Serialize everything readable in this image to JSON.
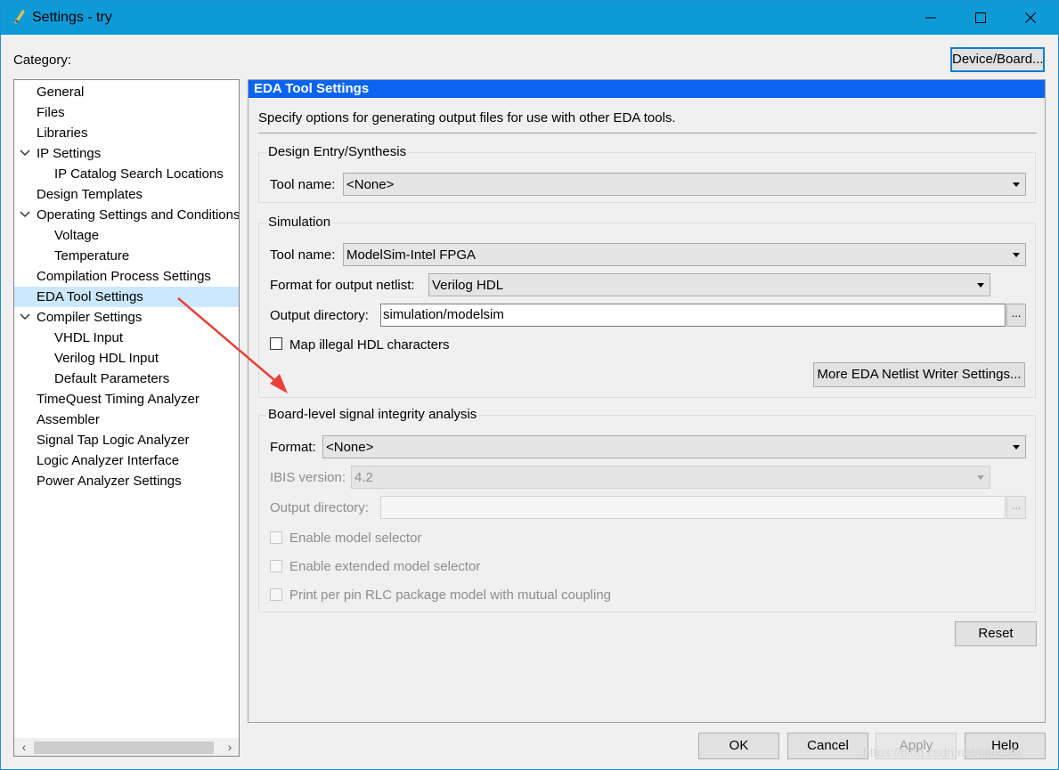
{
  "window": {
    "title": "Settings - try"
  },
  "category_label": "Category:",
  "device_board_button": "Device/Board...",
  "tree": {
    "items": [
      {
        "label": "General"
      },
      {
        "label": "Files"
      },
      {
        "label": "Libraries"
      },
      {
        "label": "IP Settings",
        "expanded": true
      },
      {
        "label": "IP Catalog Search Locations"
      },
      {
        "label": "Design Templates"
      },
      {
        "label": "Operating Settings and Conditions",
        "expanded": true
      },
      {
        "label": "Voltage"
      },
      {
        "label": "Temperature"
      },
      {
        "label": "Compilation Process Settings"
      },
      {
        "label": "EDA Tool Settings",
        "selected": true
      },
      {
        "label": "Compiler Settings",
        "expanded": true
      },
      {
        "label": "VHDL Input"
      },
      {
        "label": "Verilog HDL Input"
      },
      {
        "label": "Default Parameters"
      },
      {
        "label": "TimeQuest Timing Analyzer"
      },
      {
        "label": "Assembler"
      },
      {
        "label": "Signal Tap Logic Analyzer"
      },
      {
        "label": "Logic Analyzer Interface"
      },
      {
        "label": "Power Analyzer Settings"
      }
    ]
  },
  "panel": {
    "header": "EDA Tool Settings",
    "description": "Specify options for generating output files for use with other EDA tools.",
    "design_entry": {
      "title": "Design Entry/Synthesis",
      "tool_name_label": "Tool name:",
      "tool_name_value": "<None>"
    },
    "simulation": {
      "title": "Simulation",
      "tool_name_label": "Tool name:",
      "tool_name_value": "ModelSim-Intel FPGA",
      "format_label": "Format for output netlist:",
      "format_value": "Verilog HDL",
      "output_dir_label": "Output directory:",
      "output_dir_value": "simulation/modelsim",
      "browse": "...",
      "map_illegal_label": "Map illegal HDL characters",
      "more_button": "More EDA Netlist Writer Settings..."
    },
    "board_level": {
      "title": "Board-level signal integrity analysis",
      "format_label": "Format:",
      "format_value": "<None>",
      "ibis_label": "IBIS version:",
      "ibis_value": "4.2",
      "output_dir_label": "Output directory:",
      "output_dir_value": "",
      "browse": "...",
      "enable_model_selector": "Enable model selector",
      "enable_extended_model_selector": "Enable extended model selector",
      "print_per_pin": "Print per pin RLC package model with mutual coupling"
    },
    "reset_button": "Reset"
  },
  "footer": {
    "ok": "OK",
    "cancel": "Cancel",
    "apply": "Apply",
    "help": "Help"
  },
  "watermark": "https://blog.csdn.net/tiaocola",
  "colors": {
    "titlebar": "#0e9ad7",
    "panel_header": "#0a64f0",
    "tree_selection": "#cce8ff",
    "annotation_arrow": "#e8413a"
  }
}
